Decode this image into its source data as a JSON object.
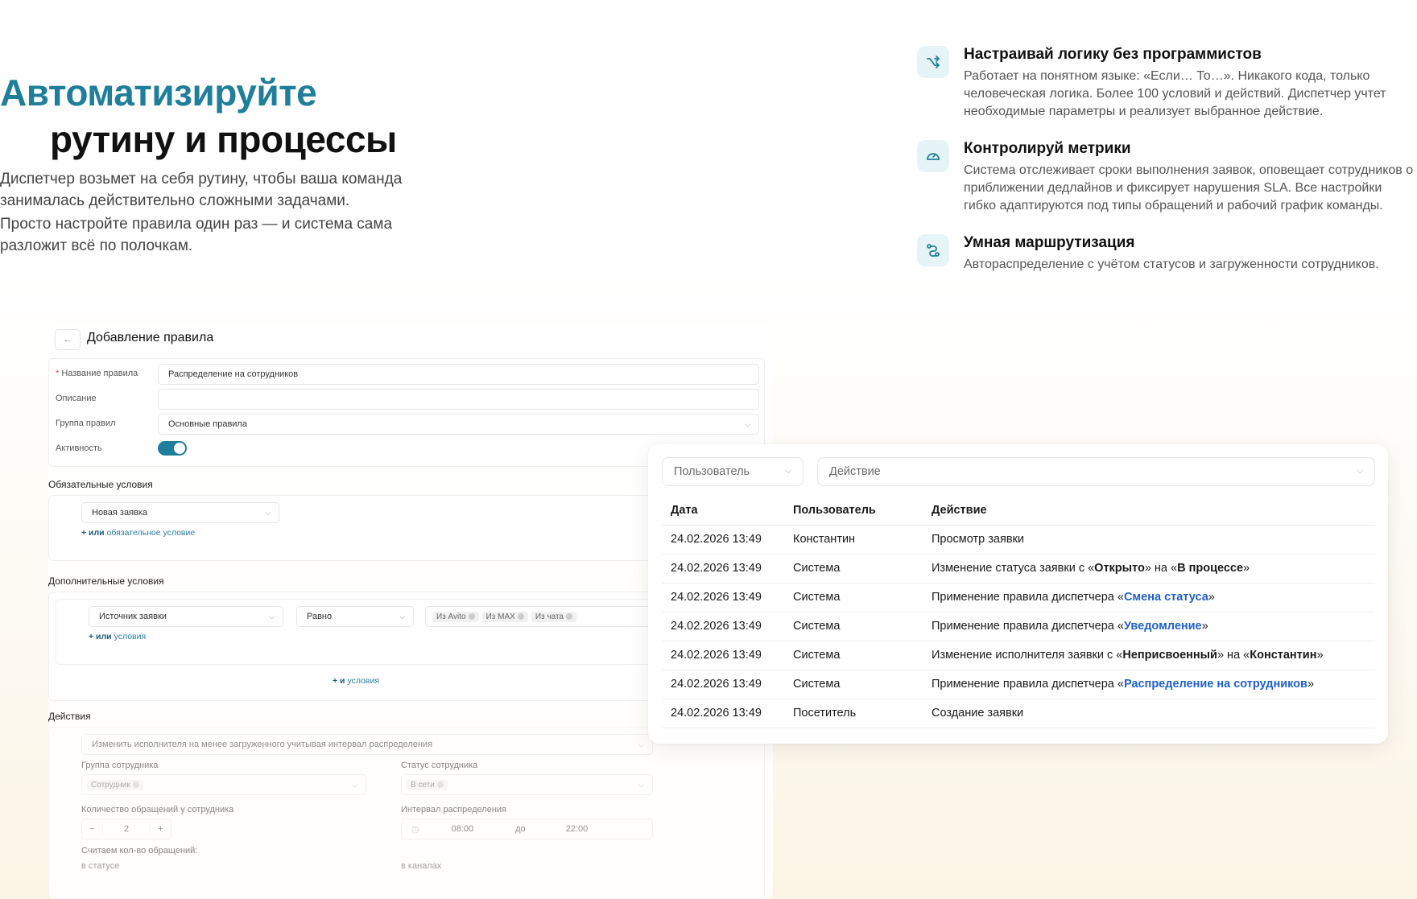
{
  "hero": {
    "title_line1": "Автоматизируйте",
    "title_line2": "рутину и процессы",
    "desc1": "Диспетчер возьмет на себя рутину, чтобы ваша команда занималась действительно сложными задачами.",
    "desc2": "Просто настройте правила один раз — и система сама разложит всё по полочкам."
  },
  "features": [
    {
      "icon": "shuffle-arrow-icon",
      "title": "Настраивай логику без программистов",
      "text": "Работает на понятном языке: «Если… То…». Никакого кода, только человеческая логика. Более 100 условий и действий. Диспетчер учтет необходимые параметры и реализует выбранное действие."
    },
    {
      "icon": "speedometer-icon",
      "title": "Контролируй метрики",
      "text": "Система отслеживает сроки выполнения заявок, оповещает сотрудников о приближении дедлайнов и фиксирует нарушения SLA. Все настройки гибко адаптируются под типы обращений и рабочий график команды."
    },
    {
      "icon": "route-icon",
      "title": "Умная маршрутизация",
      "text": "Автораспределение с учётом статусов и загруженности сотрудников."
    }
  ],
  "form": {
    "back": "←",
    "title": "Добавление правила",
    "name_label": "Название правила",
    "name_value": "Распределение на сотрудников",
    "desc_label": "Описание",
    "group_label": "Группа правил",
    "group_value": "Основные правила",
    "active_label": "Активность",
    "required_title": "Обязательные условия",
    "required_select": "Новая заявка",
    "or_word": "+ или",
    "required_link_rest": "обязательное условие",
    "extra_title": "Дополнительные условия",
    "extra_select": "Источник заявки",
    "extra_op": "Равно",
    "extra_tags": [
      "Из Avito",
      "Из MAX",
      "Из чата"
    ],
    "or_conditions_rest": "условия",
    "and_word": "+ и",
    "and_conditions_rest": "условия",
    "actions_title": "Действия",
    "action_select": "Изменить исполнителя на менее загруженного учитывая интервал распределения",
    "emp_group_label": "Группа сотрудника",
    "emp_group_tag": "Сотрудник",
    "emp_status_label": "Статус сотрудника",
    "emp_status_tag": "В сети",
    "count_label": "Количество обращений у сотрудника",
    "count_minus": "−",
    "count_value": "2",
    "count_plus": "+",
    "interval_label": "Интервал распределения",
    "interval_from": "08:00",
    "interval_to_word": "до",
    "interval_to": "22:00",
    "count_note": "Считаем кол-во обращений:",
    "in_status": "в статусе",
    "in_channels": "в каналах"
  },
  "log": {
    "filter_user": "Пользователь",
    "filter_action": "Действие",
    "headers": [
      "Дата",
      "Пользователь",
      "Действие"
    ],
    "rows": [
      {
        "date": "24.02.2026 13:49",
        "user": "Константин",
        "parts": [
          {
            "t": "Просмотр заявки"
          }
        ]
      },
      {
        "date": "24.02.2026 13:49",
        "user": "Система",
        "parts": [
          {
            "t": "Изменение статуса заявки с «"
          },
          {
            "t": "Открыто",
            "s": "b"
          },
          {
            "t": "» на «"
          },
          {
            "t": "В процессе",
            "s": "b"
          },
          {
            "t": "»"
          }
        ]
      },
      {
        "date": "24.02.2026 13:49",
        "user": "Система",
        "parts": [
          {
            "t": "Применение правила диспетчера «"
          },
          {
            "t": "Смена статуса",
            "s": "l"
          },
          {
            "t": "»"
          }
        ]
      },
      {
        "date": "24.02.2026 13:49",
        "user": "Система",
        "parts": [
          {
            "t": "Применение правила диспетчера «"
          },
          {
            "t": "Уведомление",
            "s": "l"
          },
          {
            "t": "»"
          }
        ]
      },
      {
        "date": "24.02.2026 13:49",
        "user": "Система",
        "parts": [
          {
            "t": "Изменение исполнителя заявки с «"
          },
          {
            "t": "Неприсвоенный",
            "s": "b"
          },
          {
            "t": "» на «"
          },
          {
            "t": "Константин",
            "s": "b"
          },
          {
            "t": "»"
          }
        ]
      },
      {
        "date": "24.02.2026 13:49",
        "user": "Система",
        "parts": [
          {
            "t": "Применение правила диспетчера «"
          },
          {
            "t": "Распределение на сотрудников",
            "s": "l"
          },
          {
            "t": "»"
          }
        ]
      },
      {
        "date": "24.02.2026 13:49",
        "user": "Посетитель",
        "parts": [
          {
            "t": "Создание заявки"
          }
        ]
      }
    ]
  },
  "colors": {
    "accent": "#1f7f9a",
    "link": "#1f5fcf"
  }
}
